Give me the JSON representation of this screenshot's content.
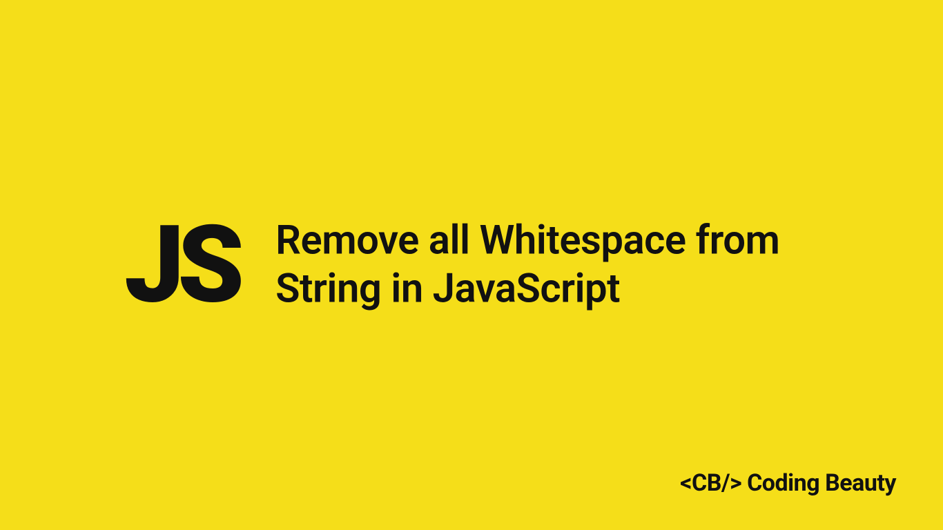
{
  "logo": "JS",
  "headline": "Remove all Whitespace from String in JavaScript",
  "branding": "<CB/> Coding Beauty"
}
